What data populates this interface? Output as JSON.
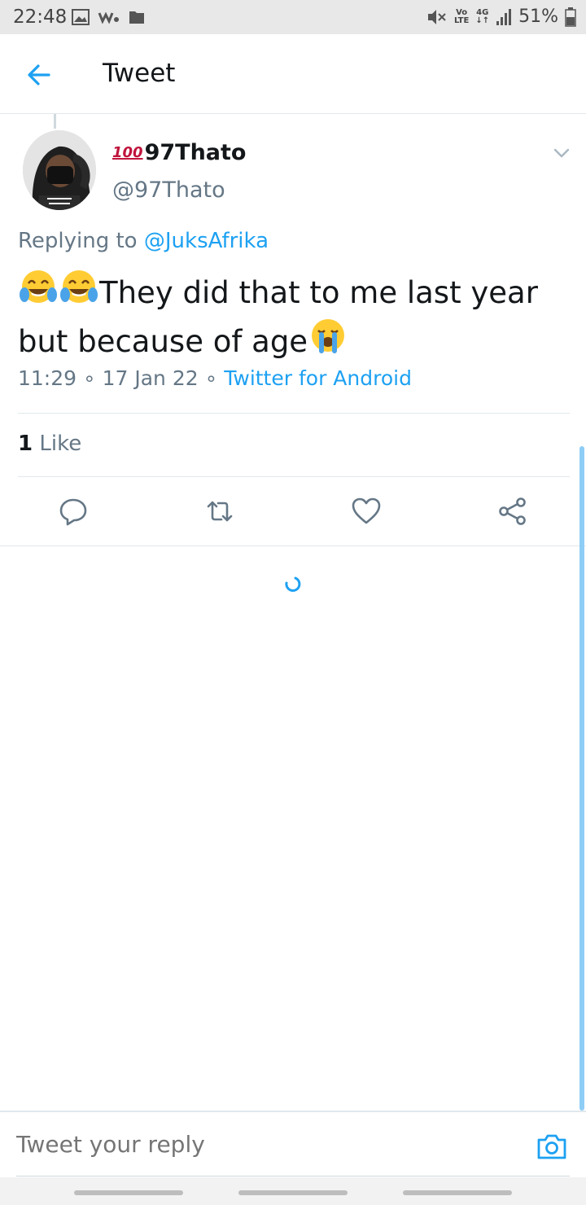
{
  "status_bar": {
    "time": "22:48",
    "battery": "51%",
    "network_top": "Vo",
    "network_bottom": "LTE",
    "network_type": "4G",
    "icons": [
      "gallery-icon",
      "walkman-icon",
      "folder-icon",
      "vibrate-mute-icon",
      "signal-icon",
      "battery-icon"
    ]
  },
  "header": {
    "title": "Tweet",
    "back_icon": "arrow-left-icon"
  },
  "tweet": {
    "badge": "100",
    "display_name": "97Thato",
    "handle": "@97Thato",
    "replying_prefix": "Replying to",
    "replying_to": "@JuksAfrika",
    "text_line1": "They did that to me last year",
    "text_line2": "but because of age",
    "emojis": [
      "face-with-tears-of-joy",
      "face-with-tears-of-joy",
      "loudly-crying-face"
    ],
    "time": "11:29",
    "date": "17 Jan 22",
    "source": "Twitter for Android",
    "sep": "∘",
    "likes_count": "1",
    "likes_label": "Like"
  },
  "actions": [
    "reply-icon",
    "retweet-icon",
    "like-icon",
    "share-icon"
  ],
  "reply_bar": {
    "placeholder": "Tweet your reply",
    "camera_icon": "camera-icon"
  },
  "colors": {
    "accent": "#1da1f2",
    "text": "#14171a",
    "muted": "#657786",
    "divider": "#e1e8ed",
    "status_bar": "#e8e8e8"
  }
}
